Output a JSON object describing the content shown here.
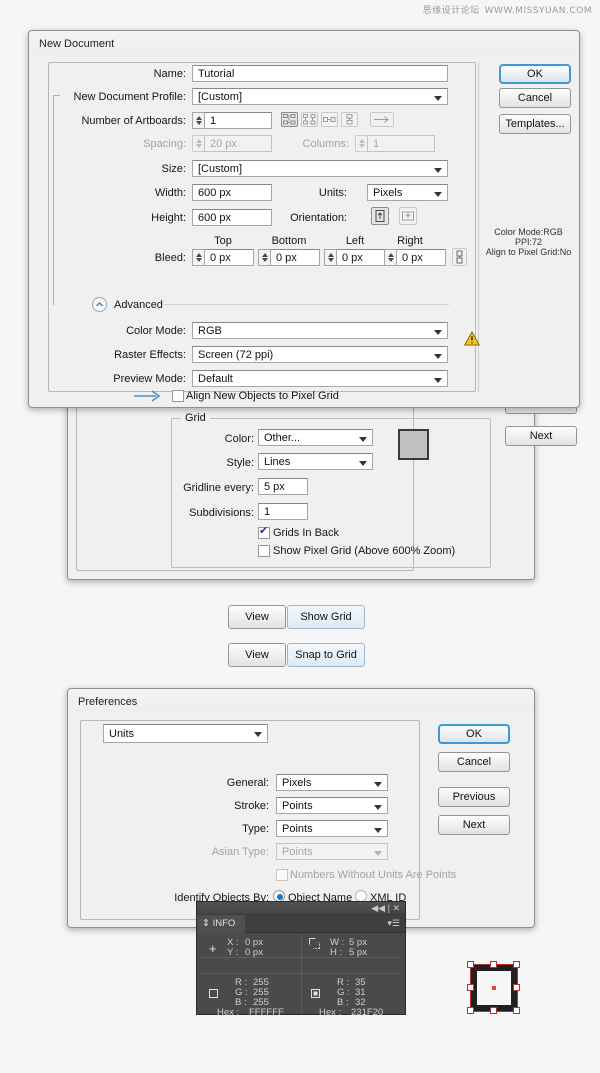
{
  "watermark": {
    "cn": "思缘设计论坛",
    "url": "WWW.MISSYUAN.COM"
  },
  "new_document": {
    "title": "New Document",
    "labels": {
      "name": "Name:",
      "profile": "New Document Profile:",
      "artboards": "Number of Artboards:",
      "spacing": "Spacing:",
      "columns": "Columns:",
      "size": "Size:",
      "width": "Width:",
      "height": "Height:",
      "units": "Units:",
      "orientation": "Orientation:",
      "bleed": "Bleed:",
      "top": "Top",
      "bottom": "Bottom",
      "left": "Left",
      "right": "Right",
      "advanced": "Advanced",
      "color_mode": "Color Mode:",
      "raster_effects": "Raster Effects:",
      "preview_mode": "Preview Mode:",
      "align_pixel_grid": "Align New Objects to Pixel Grid"
    },
    "values": {
      "name": "Tutorial",
      "profile": "[Custom]",
      "artboards": "1",
      "spacing": "20 px",
      "columns": "1",
      "size": "[Custom]",
      "width": "600 px",
      "height": "600 px",
      "units": "Pixels",
      "bleed_top": "0 px",
      "bleed_bottom": "0 px",
      "bleed_left": "0 px",
      "bleed_right": "0 px",
      "color_mode": "RGB",
      "raster_effects": "Screen (72 ppi)",
      "preview_mode": "Default"
    },
    "buttons": {
      "ok": "OK",
      "cancel": "Cancel",
      "templates": "Templates..."
    },
    "summary": {
      "line1": "Color Mode:RGB",
      "line2": "PPI:72",
      "line3": "Align to Pixel Grid:No"
    }
  },
  "grid_prefs": {
    "group_title": "Grid",
    "labels": {
      "color": "Color:",
      "style": "Style:",
      "gridline_every": "Gridline every:",
      "subdivisions": "Subdivisions:",
      "grids_in_back": "Grids In Back",
      "show_pixel_grid": "Show Pixel Grid (Above 600% Zoom)"
    },
    "values": {
      "color": "Other...",
      "style": "Lines",
      "gridline_every": "5 px",
      "subdivisions": "1"
    },
    "buttons": {
      "next": "Next"
    },
    "swatch_hex": "#c0c0c0"
  },
  "menu_hints": [
    {
      "menu": "View",
      "item": "Show Grid"
    },
    {
      "menu": "View",
      "item": "Snap to Grid"
    }
  ],
  "preferences": {
    "title": "Preferences",
    "section": "Units",
    "labels": {
      "general": "General:",
      "stroke": "Stroke:",
      "type": "Type:",
      "asian_type": "Asian Type:",
      "numbers_without_units": "Numbers Without Units Are Points",
      "identify_objects_by": "Identify Objects By:",
      "object_name": "Object Name",
      "xml_id": "XML ID"
    },
    "values": {
      "general": "Pixels",
      "stroke": "Points",
      "type": "Points",
      "asian_type": "Points"
    },
    "buttons": {
      "ok": "OK",
      "cancel": "Cancel",
      "previous": "Previous",
      "next": "Next"
    }
  },
  "info_panel": {
    "title": "INFO",
    "position": {
      "x_label": "X :",
      "x_value": "0 px",
      "y_label": "Y :",
      "y_value": "0 px"
    },
    "size": {
      "w_label": "W :",
      "w_value": "5 px",
      "h_label": "H :",
      "h_value": "5 px"
    },
    "fill": {
      "r_label": "R :",
      "r": "255",
      "g_label": "G :",
      "g": "255",
      "b_label": "B :",
      "b": "255",
      "hex_label": "Hex :",
      "hex": "FFFFFF"
    },
    "stroke": {
      "r_label": "R :",
      "r": "35",
      "g_label": "G :",
      "g": "31",
      "b_label": "B :",
      "b": "32",
      "hex_label": "Hex :",
      "hex": "231F20"
    }
  },
  "colors": {
    "accent_blue": "#3c9ad6",
    "window_bg": "#f0f0f0",
    "page_bg": "#f6f6f6",
    "art_red": "#e8413f",
    "art_dark": "#231f20"
  }
}
